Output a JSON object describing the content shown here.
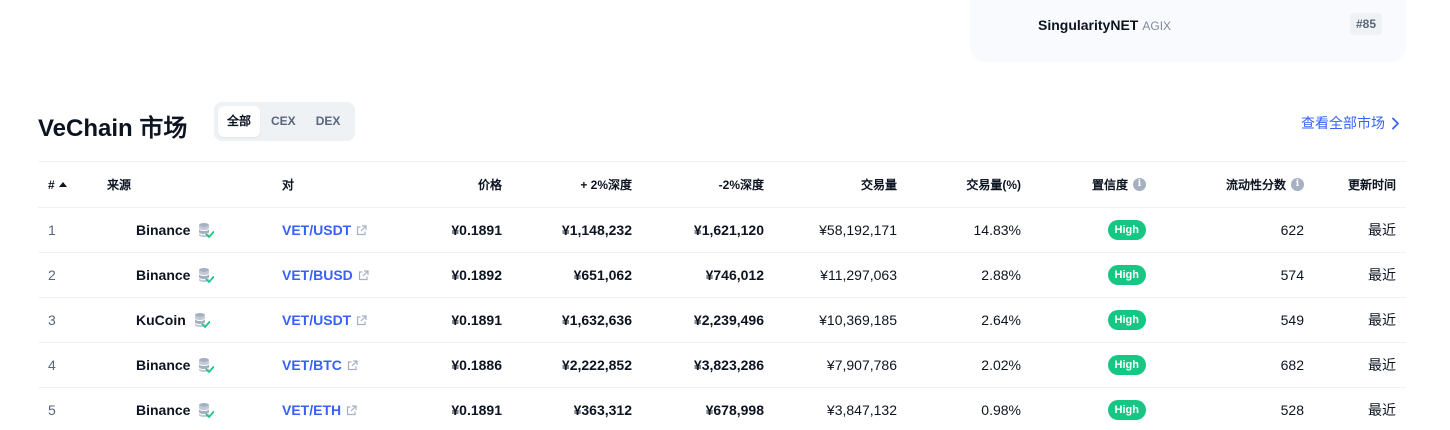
{
  "top_card": {
    "coin_name": "SingularityNET",
    "coin_symbol": "AGIX",
    "rank": "#85"
  },
  "section": {
    "title": "VeChain 市场",
    "tabs": [
      {
        "label": "全部",
        "active": true
      },
      {
        "label": "CEX",
        "active": false
      },
      {
        "label": "DEX",
        "active": false
      }
    ],
    "view_all_label": "查看全部市场"
  },
  "table": {
    "columns": {
      "rank": "#",
      "source": "来源",
      "pair": "对",
      "price": "价格",
      "plus_depth": "+ 2%深度",
      "minus_depth": "-2%深度",
      "volume": "交易量",
      "volume_pct": "交易量(%)",
      "confidence": "置信度",
      "liquidity": "流动性分数",
      "updated": "更新时间"
    },
    "rows": [
      {
        "rank": "1",
        "source": "Binance",
        "pair": "VET/USDT",
        "price": "¥0.1891",
        "plus_depth": "¥1,148,232",
        "minus_depth": "¥1,621,120",
        "volume": "¥58,192,171",
        "volume_pct": "14.83%",
        "confidence": "High",
        "liquidity": "622",
        "updated": "最近"
      },
      {
        "rank": "2",
        "source": "Binance",
        "pair": "VET/BUSD",
        "price": "¥0.1892",
        "plus_depth": "¥651,062",
        "minus_depth": "¥746,012",
        "volume": "¥11,297,063",
        "volume_pct": "2.88%",
        "confidence": "High",
        "liquidity": "574",
        "updated": "最近"
      },
      {
        "rank": "3",
        "source": "KuCoin",
        "pair": "VET/USDT",
        "price": "¥0.1891",
        "plus_depth": "¥1,632,636",
        "minus_depth": "¥2,239,496",
        "volume": "¥10,369,185",
        "volume_pct": "2.64%",
        "confidence": "High",
        "liquidity": "549",
        "updated": "最近"
      },
      {
        "rank": "4",
        "source": "Binance",
        "pair": "VET/BTC",
        "price": "¥0.1886",
        "plus_depth": "¥2,222,852",
        "minus_depth": "¥3,823,286",
        "volume": "¥7,907,786",
        "volume_pct": "2.02%",
        "confidence": "High",
        "liquidity": "682",
        "updated": "最近"
      },
      {
        "rank": "5",
        "source": "Binance",
        "pair": "VET/ETH",
        "price": "¥0.1891",
        "plus_depth": "¥363,312",
        "minus_depth": "¥678,998",
        "volume": "¥3,847,132",
        "volume_pct": "0.98%",
        "confidence": "High",
        "liquidity": "528",
        "updated": "最近"
      }
    ]
  },
  "colors": {
    "accent": "#3861fb",
    "high_badge": "#16c784",
    "text": "#0d1421",
    "muted": "#58667e"
  },
  "icons": [
    "sort-up-icon",
    "info-icon",
    "external-link-icon",
    "verified-exchange-icon",
    "chevron-right-icon"
  ]
}
